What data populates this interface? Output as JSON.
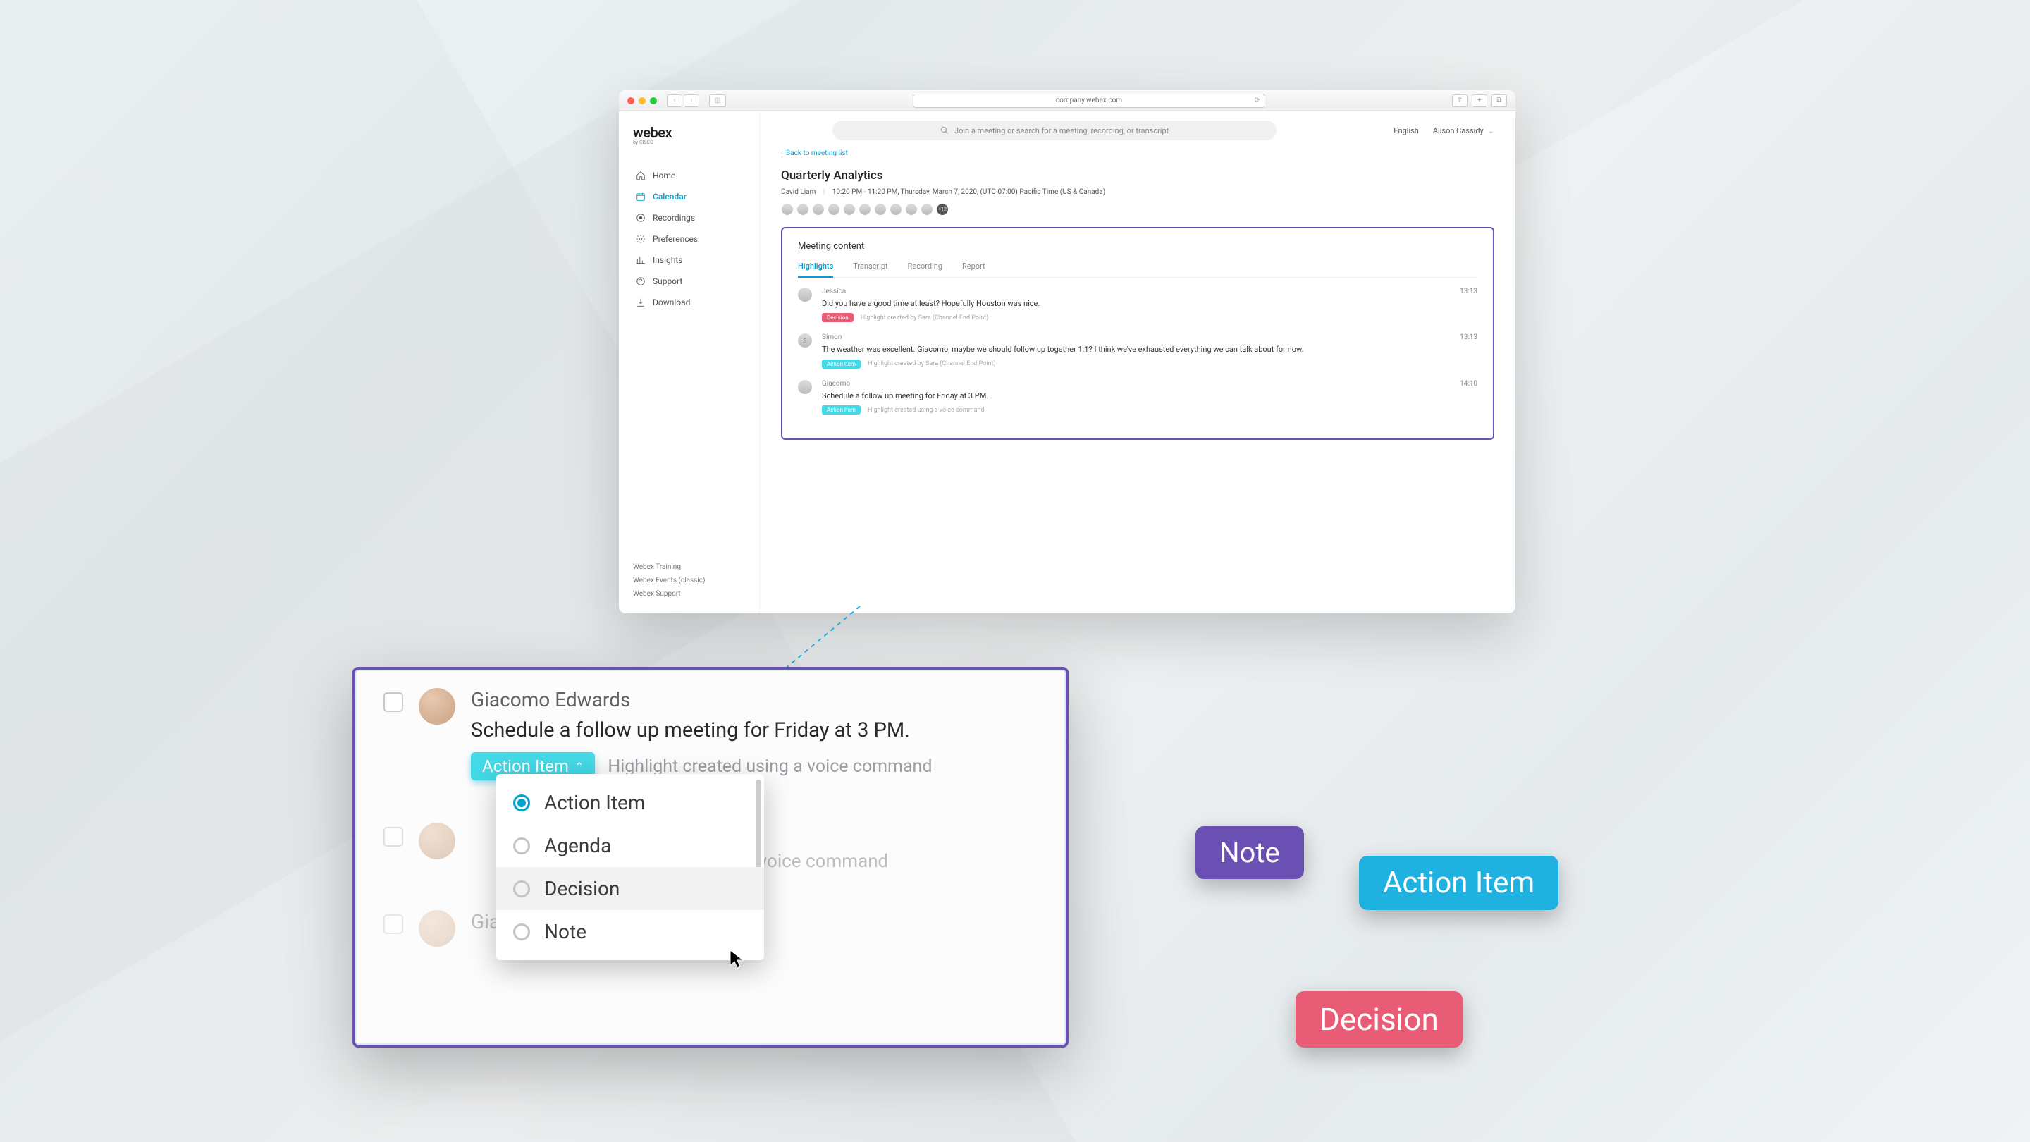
{
  "browser": {
    "url": "company.webex.com"
  },
  "app": {
    "logo": "webex",
    "logo_sub": "by CISCO",
    "search_placeholder": "Join a meeting or search for a meeting, recording, or transcript",
    "language": "English",
    "user": "Alison Cassidy"
  },
  "sidebar": {
    "items": [
      {
        "label": "Home"
      },
      {
        "label": "Calendar"
      },
      {
        "label": "Recordings"
      },
      {
        "label": "Preferences"
      },
      {
        "label": "Insights"
      },
      {
        "label": "Support"
      },
      {
        "label": "Download"
      }
    ],
    "footer": [
      "Webex Training",
      "Webex Events (classic)",
      "Webex Support"
    ]
  },
  "page": {
    "back": "Back to meeting list",
    "title": "Quarterly Analytics",
    "host": "David Liam",
    "time": "10:20 PM - 11:20 PM, Thursday, March 7, 2020, (UTC-07:00) Pacific Time (US & Canada)",
    "invitee_more": "+12",
    "card_title": "Meeting content",
    "tabs": [
      "Highlights",
      "Transcript",
      "Recording",
      "Report"
    ],
    "highlights": [
      {
        "speaker": "Jessica",
        "text": "Did you have a good time at least? Hopefully Houston was nice.",
        "tag": "Decision",
        "tag_type": "decision",
        "desc": "Highlight created by Sara (Channel End Point)",
        "time": "13:13"
      },
      {
        "speaker": "Simon",
        "text": "The weather was excellent. Giacomo, maybe we should follow up together 1:1? I think we've exhausted everything we can talk about for now.",
        "tag": "Action Item",
        "tag_type": "action",
        "desc": "Highlight created by Sara (Channel End Point)",
        "time": "13:13"
      },
      {
        "speaker": "Giacomo",
        "text": "Schedule a follow up meeting for Friday at 3 PM.",
        "tag": "Action Item",
        "tag_type": "action",
        "desc": "Highlight created using a voice command",
        "time": "14:10"
      }
    ]
  },
  "zoom": {
    "name": "Giacomo Edwards",
    "text": "Schedule a follow up meeting for Friday at 3 PM.",
    "tag": "Action Item",
    "desc": "Highlight created using a voice command",
    "dropdown": [
      "Action Item",
      "Agenda",
      "Decision",
      "Note"
    ],
    "ghost_desc": "ated using a voice command",
    "ghost_name": "Giacomo Edwards"
  },
  "chips": {
    "note": "Note",
    "action": "Action Item",
    "decision": "Decision"
  }
}
